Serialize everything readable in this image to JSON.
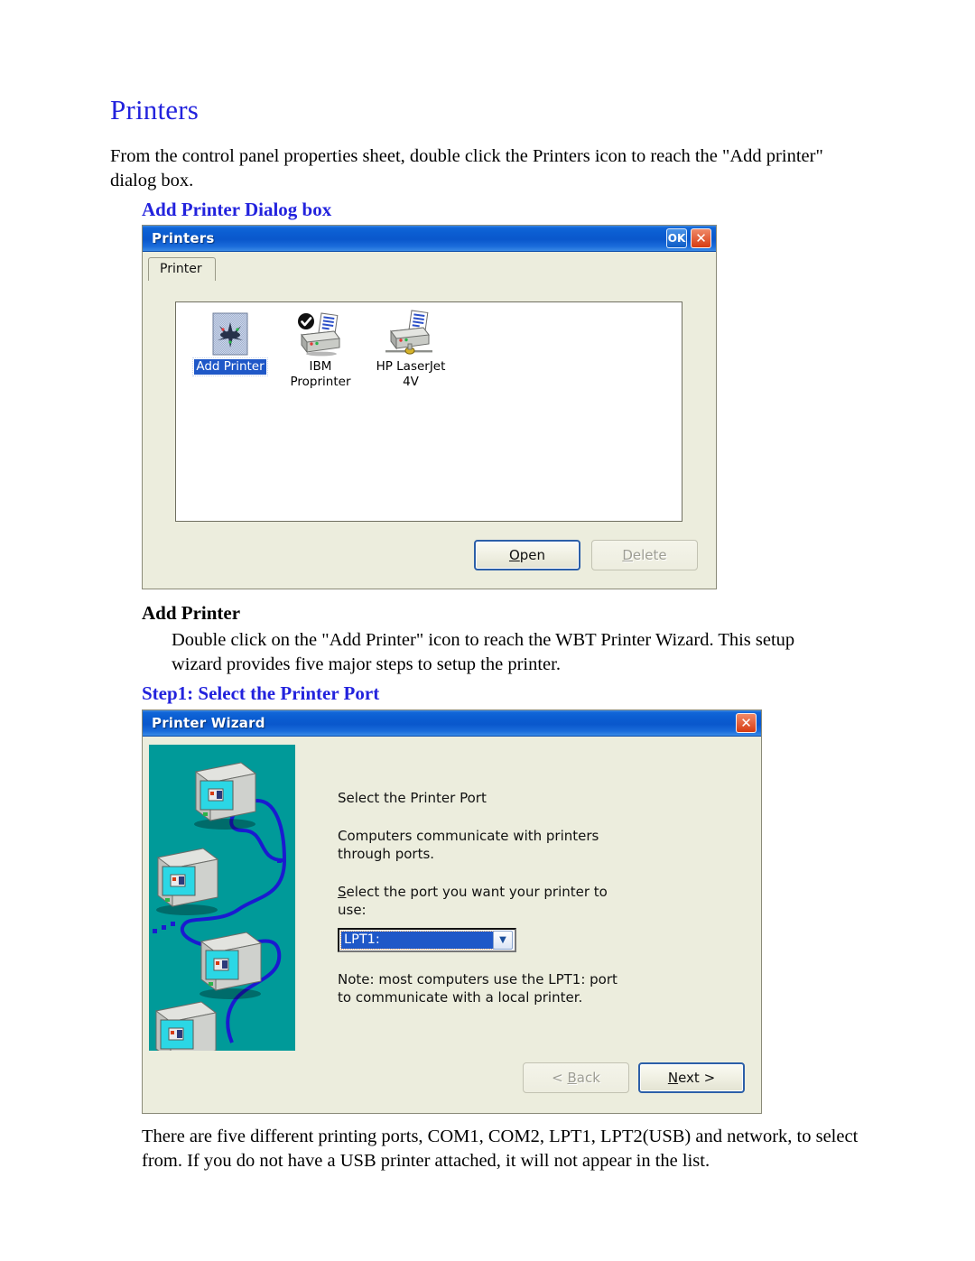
{
  "document": {
    "heading": "Printers",
    "intro_paragraph": "From the control panel properties sheet, double click the Printers icon to reach the \"Add printer\" dialog box.",
    "section_add_printer_dialog": "Add Printer Dialog box",
    "section_add_printer": "Add Printer",
    "add_printer_paragraph": "Double click on the \"Add Printer\" icon to reach the WBT Printer Wizard. This setup wizard provides five major steps to setup the printer.",
    "section_step1": "Step1: Select the Printer Port",
    "ports_paragraph": "There are five different printing ports, COM1, COM2, LPT1, LPT2(USB) and network, to select from.  If you do not have a USB printer attached, it will not appear in the list."
  },
  "printers_dialog": {
    "title": "Printers",
    "title_buttons": {
      "ok_label": "OK",
      "close_label": "✕"
    },
    "tab_label": "Printer",
    "items": [
      {
        "label_line1": "Add Printer",
        "label_line2": "",
        "icon": "add-printer-icon",
        "selected": true,
        "default_printer": false
      },
      {
        "label_line1": "IBM",
        "label_line2": "Proprinter",
        "icon": "printer-icon",
        "selected": false,
        "default_printer": true
      },
      {
        "label_line1": "HP LaserJet",
        "label_line2": "4V",
        "icon": "network-printer-icon",
        "selected": false,
        "default_printer": false
      }
    ],
    "buttons": {
      "open": {
        "prefix": "",
        "accel": "O",
        "suffix": "pen",
        "state": "default"
      },
      "delete": {
        "prefix": "",
        "accel": "D",
        "suffix": "elete",
        "state": "disabled"
      }
    }
  },
  "wizard_dialog": {
    "title": "Printer Wizard",
    "close_label": "✕",
    "heading": "Select the Printer Port",
    "description": "Computers communicate with printers through ports.",
    "prompt_accel": "S",
    "prompt_rest": "elect the port you want your printer to use:",
    "port_value": "LPT1:",
    "dropdown_icon": "chevron-down-icon",
    "note": "Note: most computers use the LPT1: port to communicate with a local printer.",
    "buttons": {
      "back": {
        "prefix": "< ",
        "accel": "B",
        "suffix": "ack",
        "state": "disabled"
      },
      "next": {
        "prefix": "",
        "accel": "N",
        "suffix": "ext >",
        "state": "default"
      }
    },
    "graphic": {
      "background_color": "#009a99",
      "cable_color": "#1a1ad0",
      "monitor_count": 4
    }
  },
  "colors": {
    "heading_blue": "#2222dd",
    "dialog_bg": "#eceddd",
    "titlebar_blue": "#0b5ed2",
    "selection_blue": "#1f58c8",
    "teal": "#009a99",
    "close_red": "#d63b12"
  }
}
